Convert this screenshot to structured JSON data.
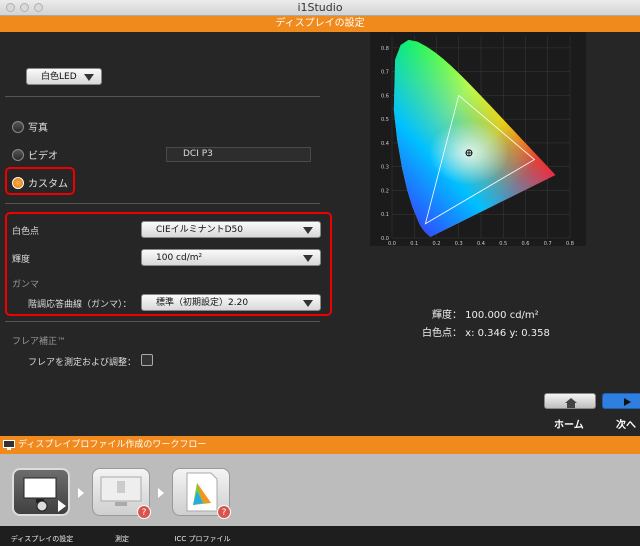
{
  "window": {
    "title": "i1Studio"
  },
  "header": {
    "title": "ディスプレイの設定"
  },
  "display_type": {
    "selected": "白色LED"
  },
  "presets": {
    "photo_label": "写真",
    "video_label": "ビデオ",
    "video_standard": "DCI P3",
    "custom_label": "カスタム",
    "selected": "カスタム"
  },
  "settings": {
    "whitepoint_label": "白色点",
    "whitepoint_value": "CIEイルミナントD50",
    "luminance_label": "輝度",
    "luminance_value": "100 cd/m²",
    "gamma_section": "ガンマ",
    "tone_curve_label": "階調応答曲線（ガンマ）：",
    "tone_curve_value": "標準（初期設定）2.20"
  },
  "flare": {
    "section_label": "フレア補正™",
    "measure_label": "フレアを測定および調整：",
    "checked": false
  },
  "chart": {
    "y_ticks": [
      "0.8",
      "0.7",
      "0.6",
      "0.5",
      "0.4",
      "0.3",
      "0.2",
      "0.1",
      "0.0"
    ],
    "x_ticks": [
      "0.0",
      "0.1",
      "0.2",
      "0.3",
      "0.4",
      "0.5",
      "0.6",
      "0.7",
      "0.8"
    ]
  },
  "chart_data": {
    "type": "scatter",
    "title": "",
    "xlabel": "",
    "ylabel": "",
    "xlim": [
      0,
      0.8
    ],
    "ylim": [
      0,
      0.85
    ],
    "grid": true,
    "gamut_triangle": [
      [
        0.64,
        0.33
      ],
      [
        0.3,
        0.6
      ],
      [
        0.15,
        0.06
      ]
    ],
    "white_point": [
      0.346,
      0.358
    ]
  },
  "readout": {
    "luminance_line": "輝度： 100.000 cd/m²",
    "whitepoint_prefix": "白色点： x: 0.346  y: 0.358"
  },
  "nav": {
    "home_label": "ホーム",
    "next_label": "次へ"
  },
  "workflow": {
    "title": "ディスプレイプロファイル作成のワークフロー",
    "steps": [
      {
        "label": "ディスプレイの設定"
      },
      {
        "label": "測定"
      },
      {
        "label": "ICC プロファイル"
      }
    ]
  },
  "colors": {
    "accent": "#f08a1c",
    "highlight": "#e00000",
    "next_button": "#2f7fe0"
  }
}
